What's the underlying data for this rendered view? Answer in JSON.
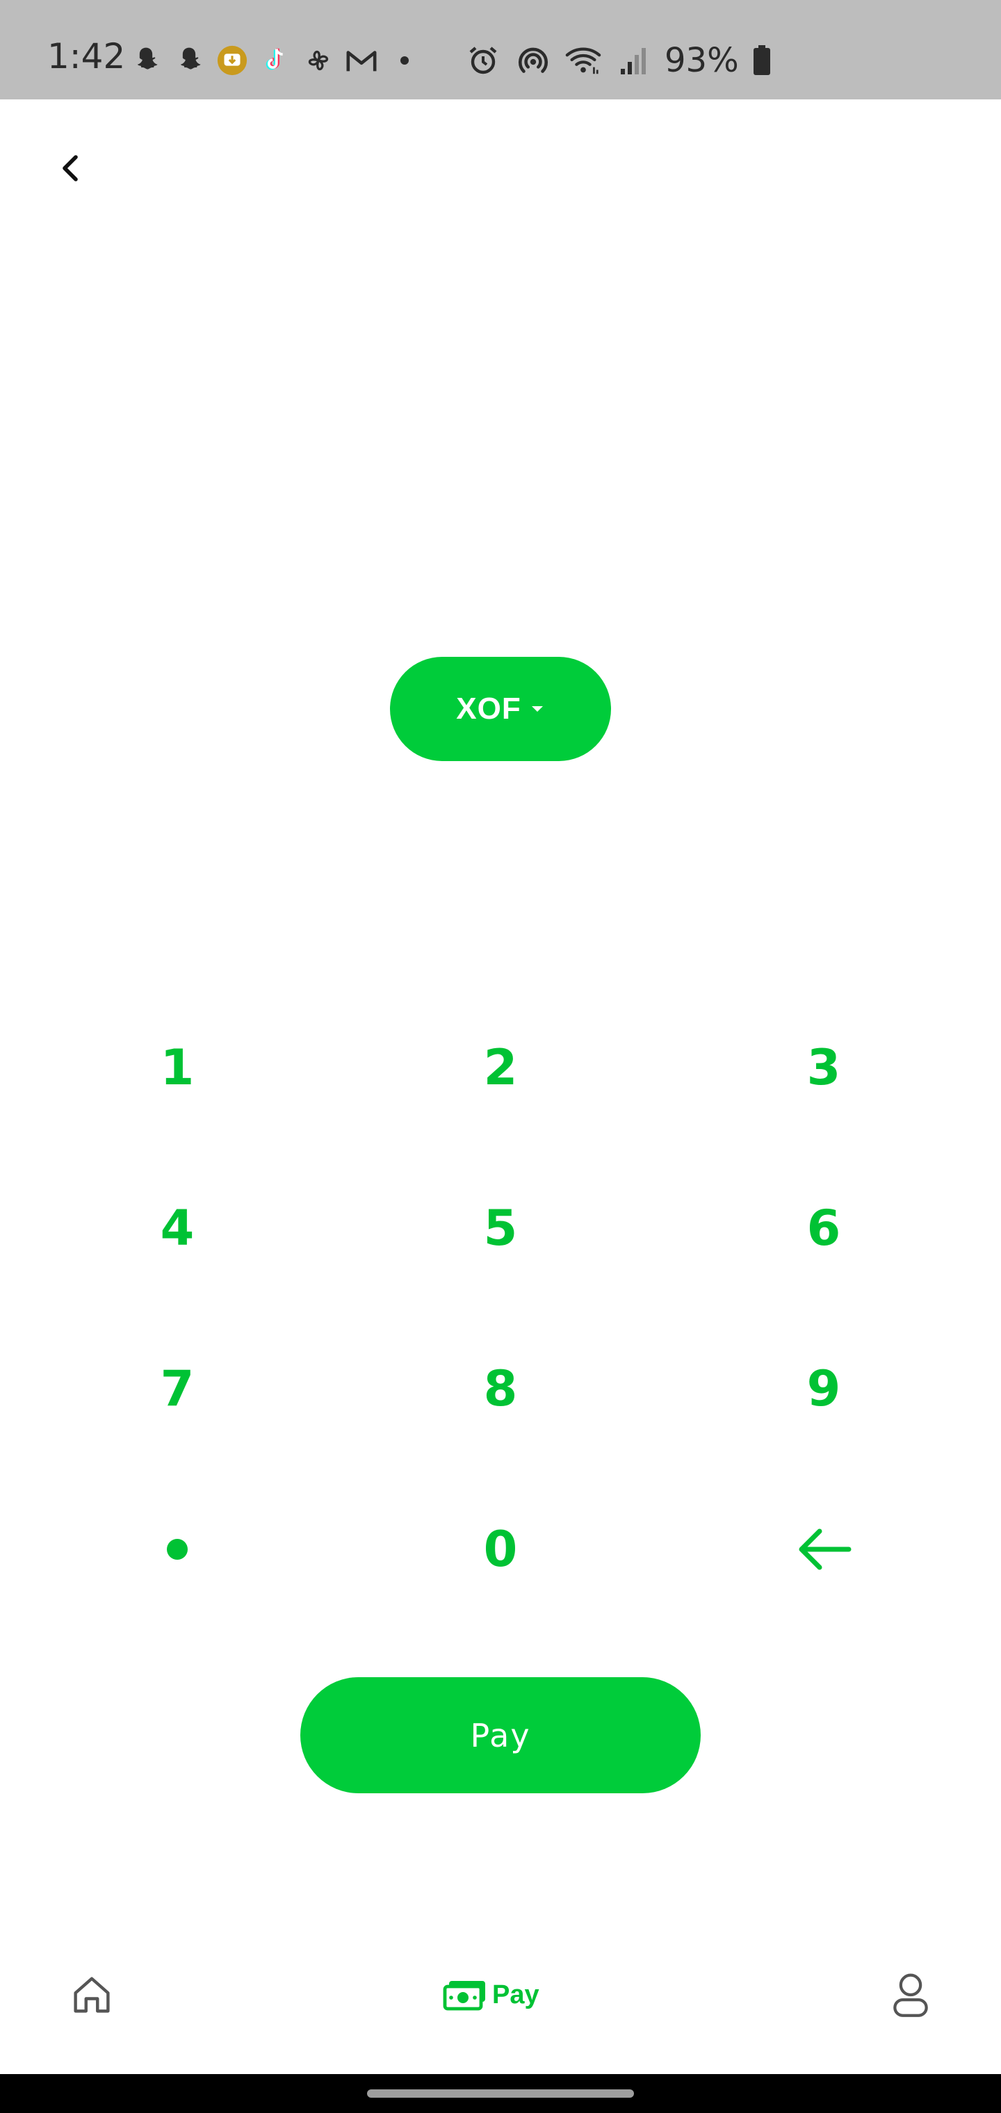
{
  "status_bar": {
    "time": "1:42",
    "battery": "93%",
    "left_icons": [
      "snapchat-icon",
      "snapchat-icon",
      "download-icon",
      "tiktok-icon",
      "pinwheel-icon",
      "gmail-icon",
      "more-dot-icon"
    ],
    "right_icons": [
      "alarm-icon",
      "hotspot-icon",
      "wifi-icon",
      "signal-icon",
      "battery-icon"
    ]
  },
  "header": {
    "back_icon": "chevron-left-icon"
  },
  "currency": {
    "code": "XOF",
    "dropdown_icon": "caret-down-icon"
  },
  "keypad": {
    "keys": [
      "1",
      "2",
      "3",
      "4",
      "5",
      "6",
      "7",
      "8",
      "9",
      "0"
    ],
    "decimal_icon": "decimal-dot-icon",
    "backspace_icon": "arrow-left-icon"
  },
  "pay_button": {
    "label": "Pay"
  },
  "bottom_nav": {
    "home_icon": "home-icon",
    "pay_label": "Pay",
    "pay_icon": "cash-icon",
    "profile_icon": "profile-icon"
  },
  "colors": {
    "accent": "#00cc3a",
    "accent_text": "#00c234",
    "status_bar": "#bdbdbd"
  }
}
